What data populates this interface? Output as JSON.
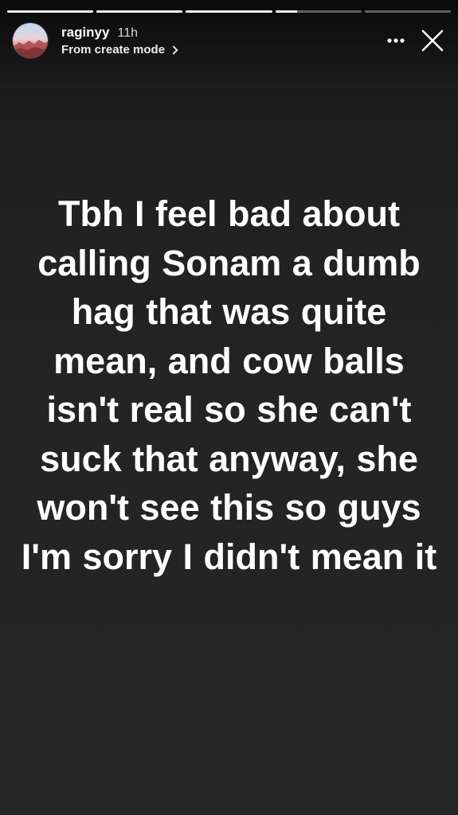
{
  "progress": {
    "segments": [
      {
        "filled": 1.0
      },
      {
        "filled": 1.0
      },
      {
        "filled": 1.0
      },
      {
        "filled": 0.25
      },
      {
        "filled": 0.0
      }
    ]
  },
  "header": {
    "username": "raginyy",
    "time": "11h",
    "source": "From create mode",
    "avatar_icon": "profile-avatar",
    "more_icon": "more-horizontal-icon",
    "close_icon": "close-icon"
  },
  "story": {
    "text": "Tbh I feel bad about calling Sonam a dumb hag that was quite mean, and cow balls isn't real so she can't suck that anyway, she won't see this so guys I'm sorry I didn't mean it",
    "text_color": "#ffffff",
    "background_color": "#242424"
  }
}
